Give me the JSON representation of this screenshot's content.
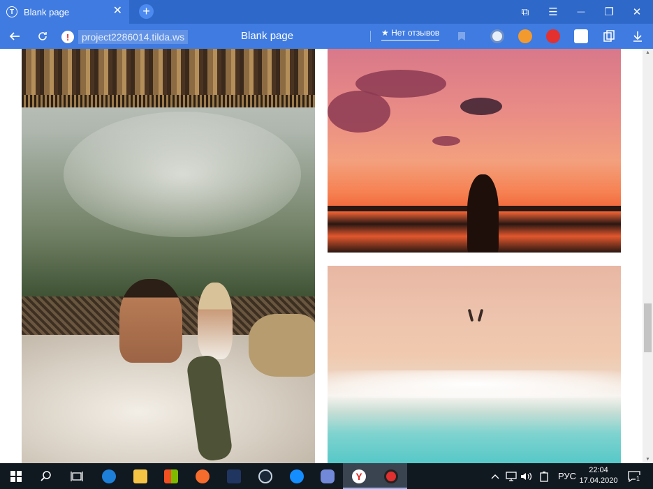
{
  "browser": {
    "tab_title": "Blank page",
    "tab_favicon": "T",
    "tab_close": "✕",
    "new_tab": "+",
    "url": "project2286014.tilda.ws",
    "page_title": "Blank page",
    "reviews_label": "★ Нет отзывов",
    "accent": "#3f7be0"
  },
  "window_controls": {
    "bookmarks_icon": "⧉",
    "menu_icon": "☰",
    "minimize": "—",
    "restore": "❐",
    "close": "✕"
  },
  "page": {
    "photos": [
      {
        "name": "couple-in-jungle-bed"
      },
      {
        "name": "sunset-silhouette"
      },
      {
        "name": "beach-aerial"
      }
    ]
  },
  "taskbar": {
    "language": "РУС",
    "time": "22:04",
    "date": "17.04.2020",
    "notification_count": "1"
  }
}
